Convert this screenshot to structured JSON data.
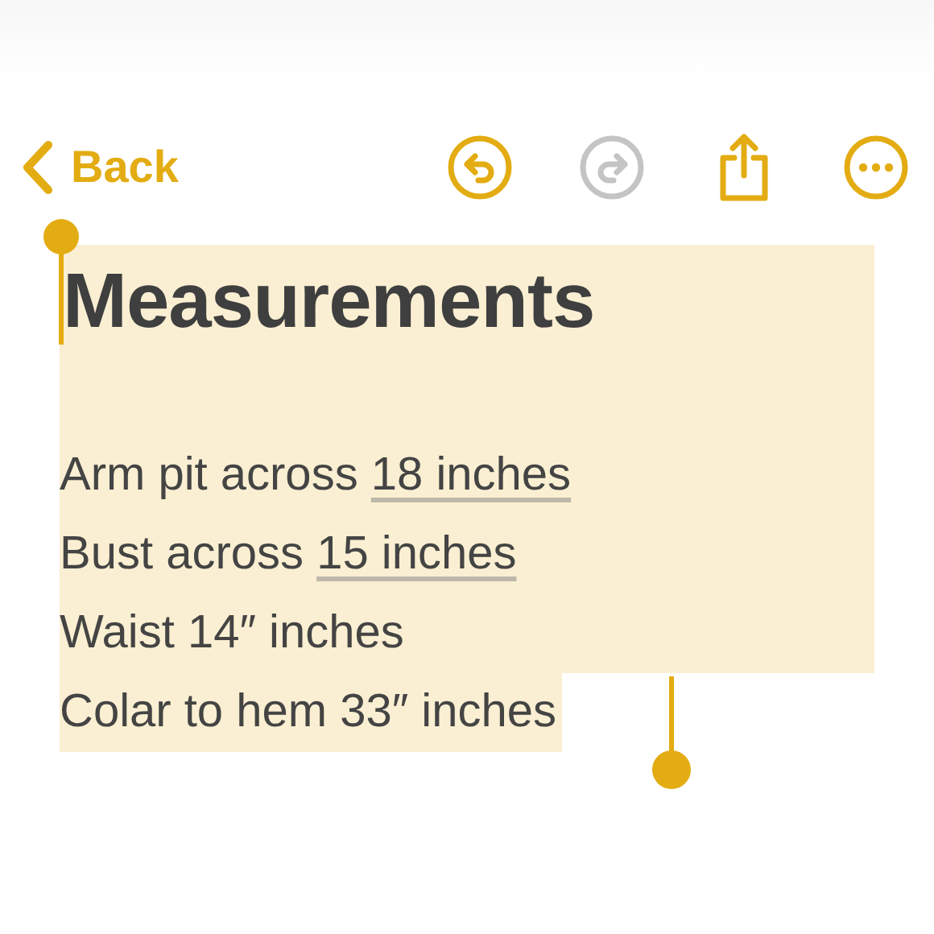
{
  "toolbar": {
    "back": {
      "label": "Back"
    },
    "buttons": [
      {
        "kind": "undo",
        "disabled": false
      },
      {
        "kind": "redo",
        "disabled": true
      },
      {
        "kind": "share",
        "disabled": false
      },
      {
        "kind": "more",
        "disabled": false
      }
    ]
  },
  "note": {
    "selected": true,
    "title": "Measurements",
    "lines": [
      {
        "text": "Arm pit across ",
        "link": "18 inches"
      },
      {
        "text": "Bust across ",
        "link": "15 inches"
      },
      {
        "text": "Waist 14″ inches"
      },
      {
        "text": "Colar to hem 33″ inches"
      }
    ]
  }
}
